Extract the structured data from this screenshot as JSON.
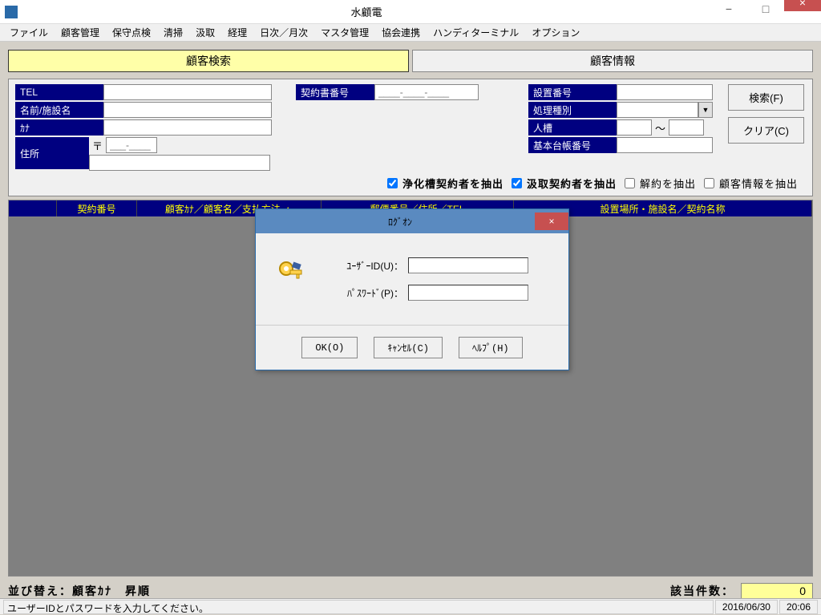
{
  "window": {
    "title": "水顧電",
    "minimize": "−",
    "maximize": "□",
    "close": "×"
  },
  "menu": [
    "ファイル",
    "顧客管理",
    "保守点検",
    "清掃",
    "汲取",
    "経理",
    "日次／月次",
    "マスタ管理",
    "協会連携",
    "ハンディターミナル",
    "オプション"
  ],
  "tabs": {
    "search": "顧客検索",
    "info": "顧客情報"
  },
  "labels": {
    "tel": "TEL",
    "name": "名前/施設名",
    "kana": "ｶﾅ",
    "addr": "住所",
    "postal": "〒",
    "contract_no": "契約書番号",
    "install_no": "設置番号",
    "process_type": "処理種別",
    "capacity": "人槽",
    "capacity_sep": "～",
    "ledger_no": "基本台帳番号"
  },
  "placeholders": {
    "contract_no": "____-____-____",
    "postal": "___-____"
  },
  "buttons": {
    "search": "検索(F)",
    "clear": "クリア(C)"
  },
  "checks": {
    "jokaso": "浄化槽契約者を抽出",
    "kumitori": "汲取契約者を抽出",
    "kaiyaku": "解約を抽出",
    "kokyaku": "顧客情報を抽出"
  },
  "table_headers": [
    "",
    "契約番号",
    "顧客ｶﾅ／顧客名／支払方法 ▲",
    "郵便番号／住所／TEL",
    "設置場所・施設名／契約名称"
  ],
  "bottom": {
    "sort": "並び替え：顧客ｶﾅ　昇順",
    "count_label": "該当件数：",
    "count_value": "0"
  },
  "status": {
    "msg": "ユーザーIDとパスワードを入力してください。",
    "date": "2016/06/30",
    "time": "20:06"
  },
  "dialog": {
    "title": "ﾛｸﾞｵﾝ",
    "user_label": "ﾕｰｻﾞｰID(U)：",
    "pass_label": "ﾊﾟｽﾜｰﾄﾞ(P)：",
    "ok": "OK(O)",
    "cancel": "ｷｬﾝｾﾙ(C)",
    "help": "ﾍﾙﾌﾟ(H)",
    "close": "×"
  }
}
